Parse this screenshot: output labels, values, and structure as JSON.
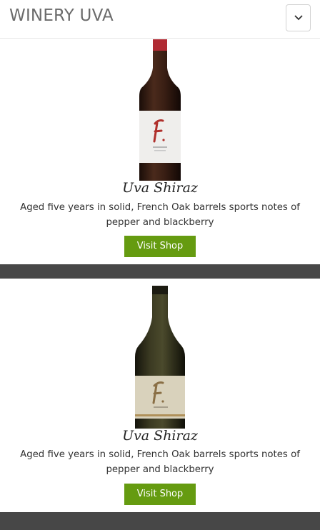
{
  "header": {
    "brand": "WINERY UVA",
    "menu_icon": "chevron-down-icon"
  },
  "products": [
    {
      "name": "Uva Shiraz",
      "description": "Aged five years in solid, French Oak barrels sports notes of pepper and blackberry",
      "button_label": "Visit Shop"
    },
    {
      "name": "Uva Shiraz",
      "description": "Aged five years in solid, French Oak barrels sports notes of pepper and blackberry",
      "button_label": "Visit Shop"
    }
  ],
  "colors": {
    "button": "#659b10",
    "separator": "#474747",
    "brand_text": "#6b6b6b"
  }
}
